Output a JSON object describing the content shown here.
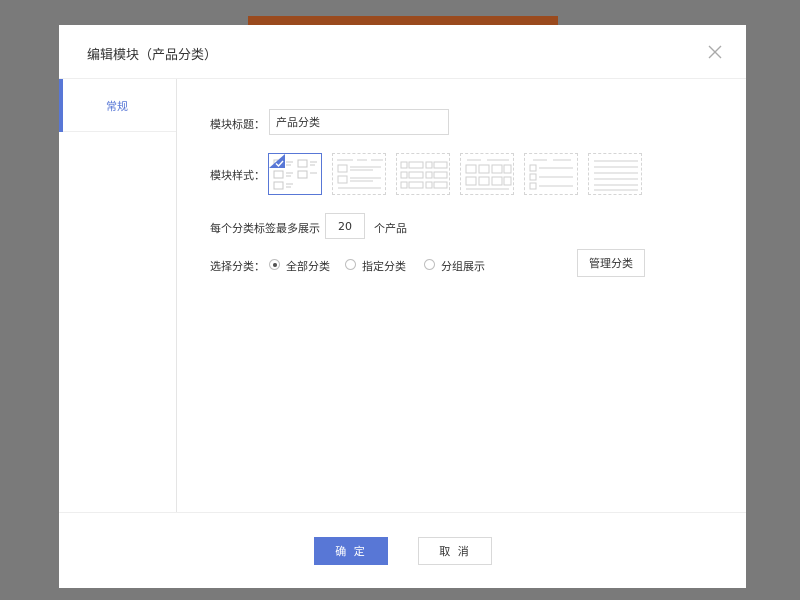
{
  "dialog": {
    "title": "编辑模块（产品分类）",
    "close_icon": "close-icon"
  },
  "sidebar": {
    "tabs": [
      {
        "label": "常规",
        "active": true
      }
    ]
  },
  "form": {
    "module_title": {
      "label": "模块标题：",
      "value": "产品分类"
    },
    "module_style": {
      "label": "模块样式：",
      "selected_index": 0,
      "option_count": 6
    },
    "per_tag": {
      "label_prefix": "每个分类标签最多展示",
      "value": "20",
      "label_suffix": "个产品"
    },
    "select_category": {
      "label": "选择分类：",
      "options": [
        {
          "label": "全部分类",
          "checked": true
        },
        {
          "label": "指定分类",
          "checked": false
        },
        {
          "label": "分组展示",
          "checked": false
        }
      ]
    },
    "manage_button": "管理分类"
  },
  "footer": {
    "ok_label": "确 定",
    "cancel_label": "取 消"
  },
  "colors": {
    "accent": "#5877d6",
    "overlay": "#7a7a7a",
    "border": "#d9d9d9"
  }
}
